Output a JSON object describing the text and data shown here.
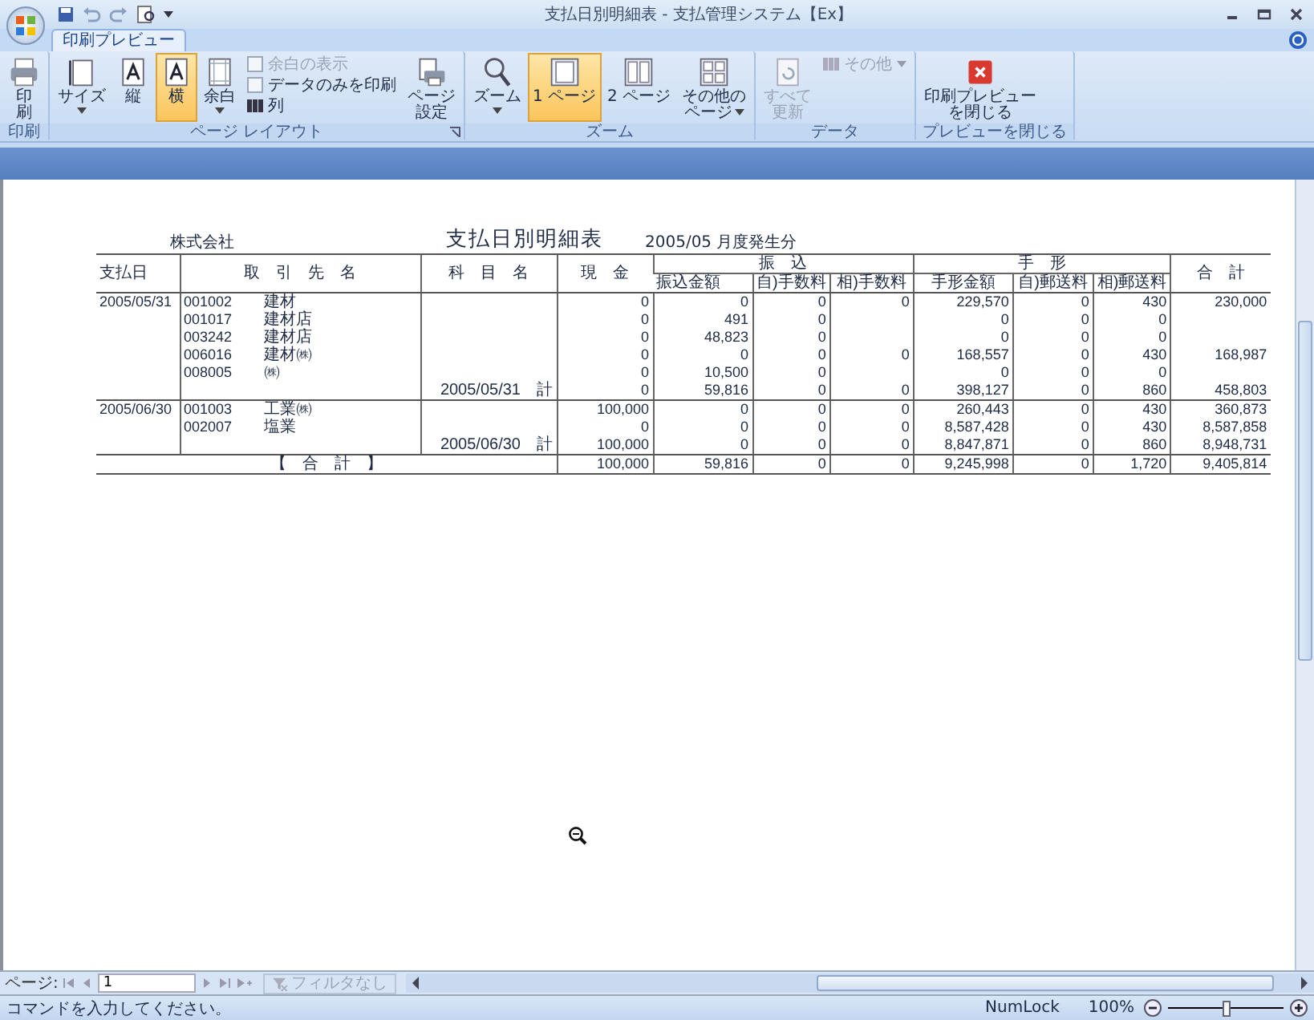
{
  "title_bar": {
    "title": "支払日別明細表 - 支払管理システム【Ex】"
  },
  "tabs": [
    {
      "label": "印刷プレビュー",
      "selected": true
    }
  ],
  "ribbon": [
    {
      "label": "印刷",
      "launcher": false,
      "items": [
        {
          "kind": "large",
          "lines": [
            "印",
            "刷"
          ],
          "dropdown": false,
          "selected": false,
          "disabled": false
        }
      ]
    },
    {
      "label": "ページ レイアウト",
      "launcher": true,
      "items": [
        {
          "kind": "large",
          "lines": [
            "サイズ"
          ],
          "dropdown": true,
          "selected": false,
          "disabled": false
        },
        {
          "kind": "large",
          "lines": [
            "縦"
          ],
          "dropdown": false,
          "selected": false,
          "disabled": false
        },
        {
          "kind": "large",
          "lines": [
            "横"
          ],
          "dropdown": false,
          "selected": true,
          "disabled": false
        },
        {
          "kind": "large",
          "lines": [
            "余白"
          ],
          "dropdown": true,
          "selected": false,
          "disabled": false
        },
        {
          "kind": "stack",
          "entries": [
            {
              "kind": "checkbox",
              "label": "余白の表示",
              "checked": false,
              "disabled": true
            },
            {
              "kind": "checkbox",
              "label": "データのみを印刷",
              "checked": false,
              "disabled": false
            },
            {
              "kind": "button",
              "label": "列",
              "disabled": false
            }
          ]
        },
        {
          "kind": "large",
          "lines": [
            "ページ",
            "設定"
          ],
          "dropdown": false,
          "selected": false,
          "disabled": false
        }
      ]
    },
    {
      "label": "ズーム",
      "launcher": false,
      "items": [
        {
          "kind": "large",
          "lines": [
            "ズーム"
          ],
          "dropdown": true,
          "selected": false,
          "disabled": false
        },
        {
          "kind": "large",
          "lines": [
            "1 ページ"
          ],
          "dropdown": false,
          "selected": true,
          "disabled": false
        },
        {
          "kind": "large",
          "lines": [
            "2 ページ"
          ],
          "dropdown": false,
          "selected": false,
          "disabled": false
        },
        {
          "kind": "large",
          "lines": [
            "その他の",
            "ページ"
          ],
          "dropdown": true,
          "selected": false,
          "disabled": false
        }
      ]
    },
    {
      "label": "データ",
      "launcher": false,
      "items": [
        {
          "kind": "large",
          "lines": [
            "すべて",
            "更新"
          ],
          "dropdown": false,
          "selected": false,
          "disabled": true
        },
        {
          "kind": "stack",
          "entries": [
            {
              "kind": "button",
              "label": "その他",
              "disabled": true
            }
          ]
        }
      ]
    },
    {
      "label": "プレビューを閉じる",
      "launcher": false,
      "items": [
        {
          "kind": "large",
          "lines": [
            "印刷プレビュー",
            "を閉じる"
          ],
          "dropdown": false,
          "selected": false,
          "disabled": false
        }
      ]
    }
  ],
  "report": {
    "company": "株式会社",
    "title": "支払日別明細表",
    "period": "2005/05 月度発生分",
    "columns": [
      {
        "label": "支払日"
      },
      {
        "label": "取　引　先　名"
      },
      {
        "label": "科　目　名"
      },
      {
        "label": "現　金"
      },
      {
        "label": "振　込",
        "children": [
          {
            "label": "振込金額"
          },
          {
            "label": "自)手数料"
          },
          {
            "label": "相)手数料"
          }
        ]
      },
      {
        "label": "手　形",
        "children": [
          {
            "label": "手形金額"
          },
          {
            "label": "自)郵送料"
          },
          {
            "label": "相)郵送料"
          }
        ]
      },
      {
        "label": "合　計"
      }
    ],
    "rows": [
      {
        "kind": "detail",
        "date": "2005/05/31",
        "code": "001002",
        "name": "建材",
        "amounts": {
          "cash": "0",
          "transfer": "0",
          "fee_own": "0",
          "fee_other": "0",
          "bill": "229,570",
          "postage_own": "0",
          "postage_other": "430",
          "total": "230,000"
        }
      },
      {
        "kind": "detail",
        "code": "001017",
        "name": "建材店",
        "amounts": {
          "cash": "0",
          "transfer": "491",
          "fee_own": "0",
          "bill": "0",
          "postage_own": "0",
          "postage_other": "0"
        }
      },
      {
        "kind": "detail",
        "code": "003242",
        "name": "建材店",
        "amounts": {
          "cash": "0",
          "transfer": "48,823",
          "fee_own": "0",
          "bill": "0",
          "postage_own": "0",
          "postage_other": "0"
        }
      },
      {
        "kind": "detail",
        "code": "006016",
        "name": "建材㈱",
        "amounts": {
          "cash": "0",
          "transfer": "0",
          "fee_own": "0",
          "fee_other": "0",
          "bill": "168,557",
          "postage_own": "0",
          "postage_other": "430",
          "total": "168,987"
        }
      },
      {
        "kind": "detail",
        "code": "008005",
        "name": "㈱",
        "amounts": {
          "cash": "0",
          "transfer": "10,500",
          "fee_own": "0",
          "bill": "0",
          "postage_own": "0",
          "postage_other": "0"
        }
      },
      {
        "kind": "subtotal",
        "label": "2005/05/31　計",
        "amounts": {
          "cash": "0",
          "transfer": "59,816",
          "fee_own": "0",
          "fee_other": "0",
          "bill": "398,127",
          "postage_own": "0",
          "postage_other": "860",
          "total": "458,803"
        }
      },
      {
        "kind": "detail",
        "date": "2005/06/30",
        "code": "001003",
        "name": "工業㈱",
        "amounts": {
          "cash": "100,000",
          "transfer": "0",
          "fee_own": "0",
          "fee_other": "0",
          "bill": "260,443",
          "postage_own": "0",
          "postage_other": "430",
          "total": "360,873"
        }
      },
      {
        "kind": "detail",
        "code": "002007",
        "name": "塩業",
        "amounts": {
          "cash": "0",
          "transfer": "0",
          "fee_own": "0",
          "fee_other": "0",
          "bill": "8,587,428",
          "postage_own": "0",
          "postage_other": "430",
          "total": "8,587,858"
        }
      },
      {
        "kind": "subtotal",
        "label": "2005/06/30　計",
        "amounts": {
          "cash": "100,000",
          "transfer": "0",
          "fee_own": "0",
          "fee_other": "0",
          "bill": "8,847,871",
          "postage_own": "0",
          "postage_other": "860",
          "total": "8,948,731"
        }
      },
      {
        "kind": "total",
        "caption": "【　合　計　】",
        "amounts": {
          "cash": "100,000",
          "transfer": "59,816",
          "fee_own": "0",
          "fee_other": "0",
          "bill": "9,245,998",
          "postage_own": "0",
          "postage_other": "1,720",
          "total": "9,405,814"
        }
      }
    ]
  },
  "nav_bar": {
    "label": "ページ:",
    "page": "1",
    "filter": "フィルタなし"
  },
  "status_bar": {
    "message": "コマンドを入力してください。",
    "indicator": "NumLock",
    "zoom": "100%",
    "level": 0.5
  }
}
